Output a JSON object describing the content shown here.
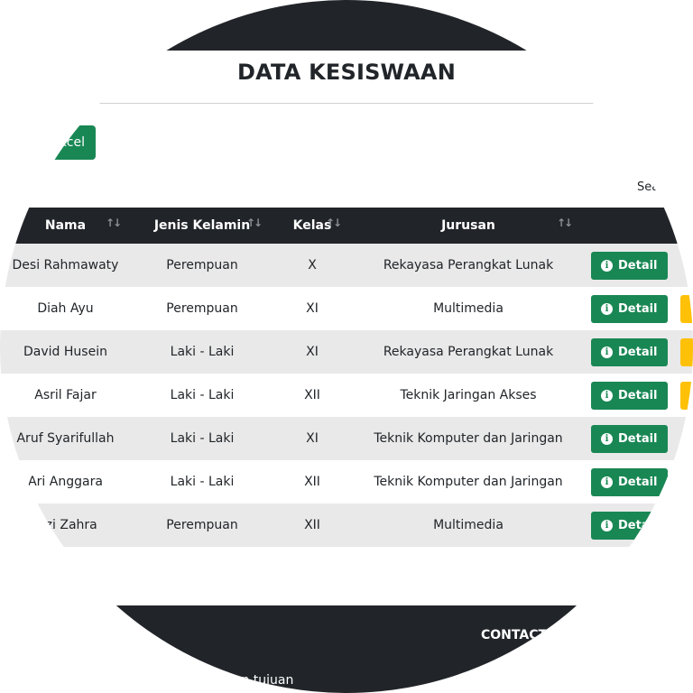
{
  "page": {
    "title": "DATA KESISWAAN",
    "excel_label": "Excel",
    "search_label": "Search:"
  },
  "table": {
    "columns": [
      "Nama",
      "Jenis Kelamin",
      "Kelas",
      "Jurusan"
    ],
    "rows": [
      {
        "nama": "Desi Rahmawaty",
        "jk": "Perempuan",
        "kelas": "X",
        "jurusan": "Rekayasa Perangkat Lunak",
        "detail": "Detail"
      },
      {
        "nama": "Diah Ayu",
        "jk": "Perempuan",
        "kelas": "XI",
        "jurusan": "Multimedia",
        "detail": "Detail"
      },
      {
        "nama": "David Husein",
        "jk": "Laki - Laki",
        "kelas": "XI",
        "jurusan": "Rekayasa Perangkat Lunak",
        "detail": "Detail"
      },
      {
        "nama": "Asril Fajar",
        "jk": "Laki - Laki",
        "kelas": "XII",
        "jurusan": "Teknik Jaringan Akses",
        "detail": "Detail"
      },
      {
        "nama": "Aruf Syarifullah",
        "jk": "Laki - Laki",
        "kelas": "XI",
        "jurusan": "Teknik Komputer dan Jaringan",
        "detail": "Detail"
      },
      {
        "nama": "Ari Anggara",
        "jk": "Laki - Laki",
        "kelas": "XII",
        "jurusan": "Teknik Komputer dan Jaringan",
        "detail": "Detail"
      },
      {
        "nama": "Aizi Zahra",
        "jk": "Perempuan",
        "kelas": "XII",
        "jurusan": "Multimedia",
        "detail": "Detail"
      }
    ]
  },
  "footer": {
    "contact_label": "CONTACT",
    "text": "dan tujuan"
  },
  "icons": {
    "sort": "sort-icon",
    "info": "info-icon"
  },
  "colors": {
    "dark": "#212529",
    "success": "#198754",
    "warning": "#ffc107",
    "stripe": "#e9e9e9"
  }
}
